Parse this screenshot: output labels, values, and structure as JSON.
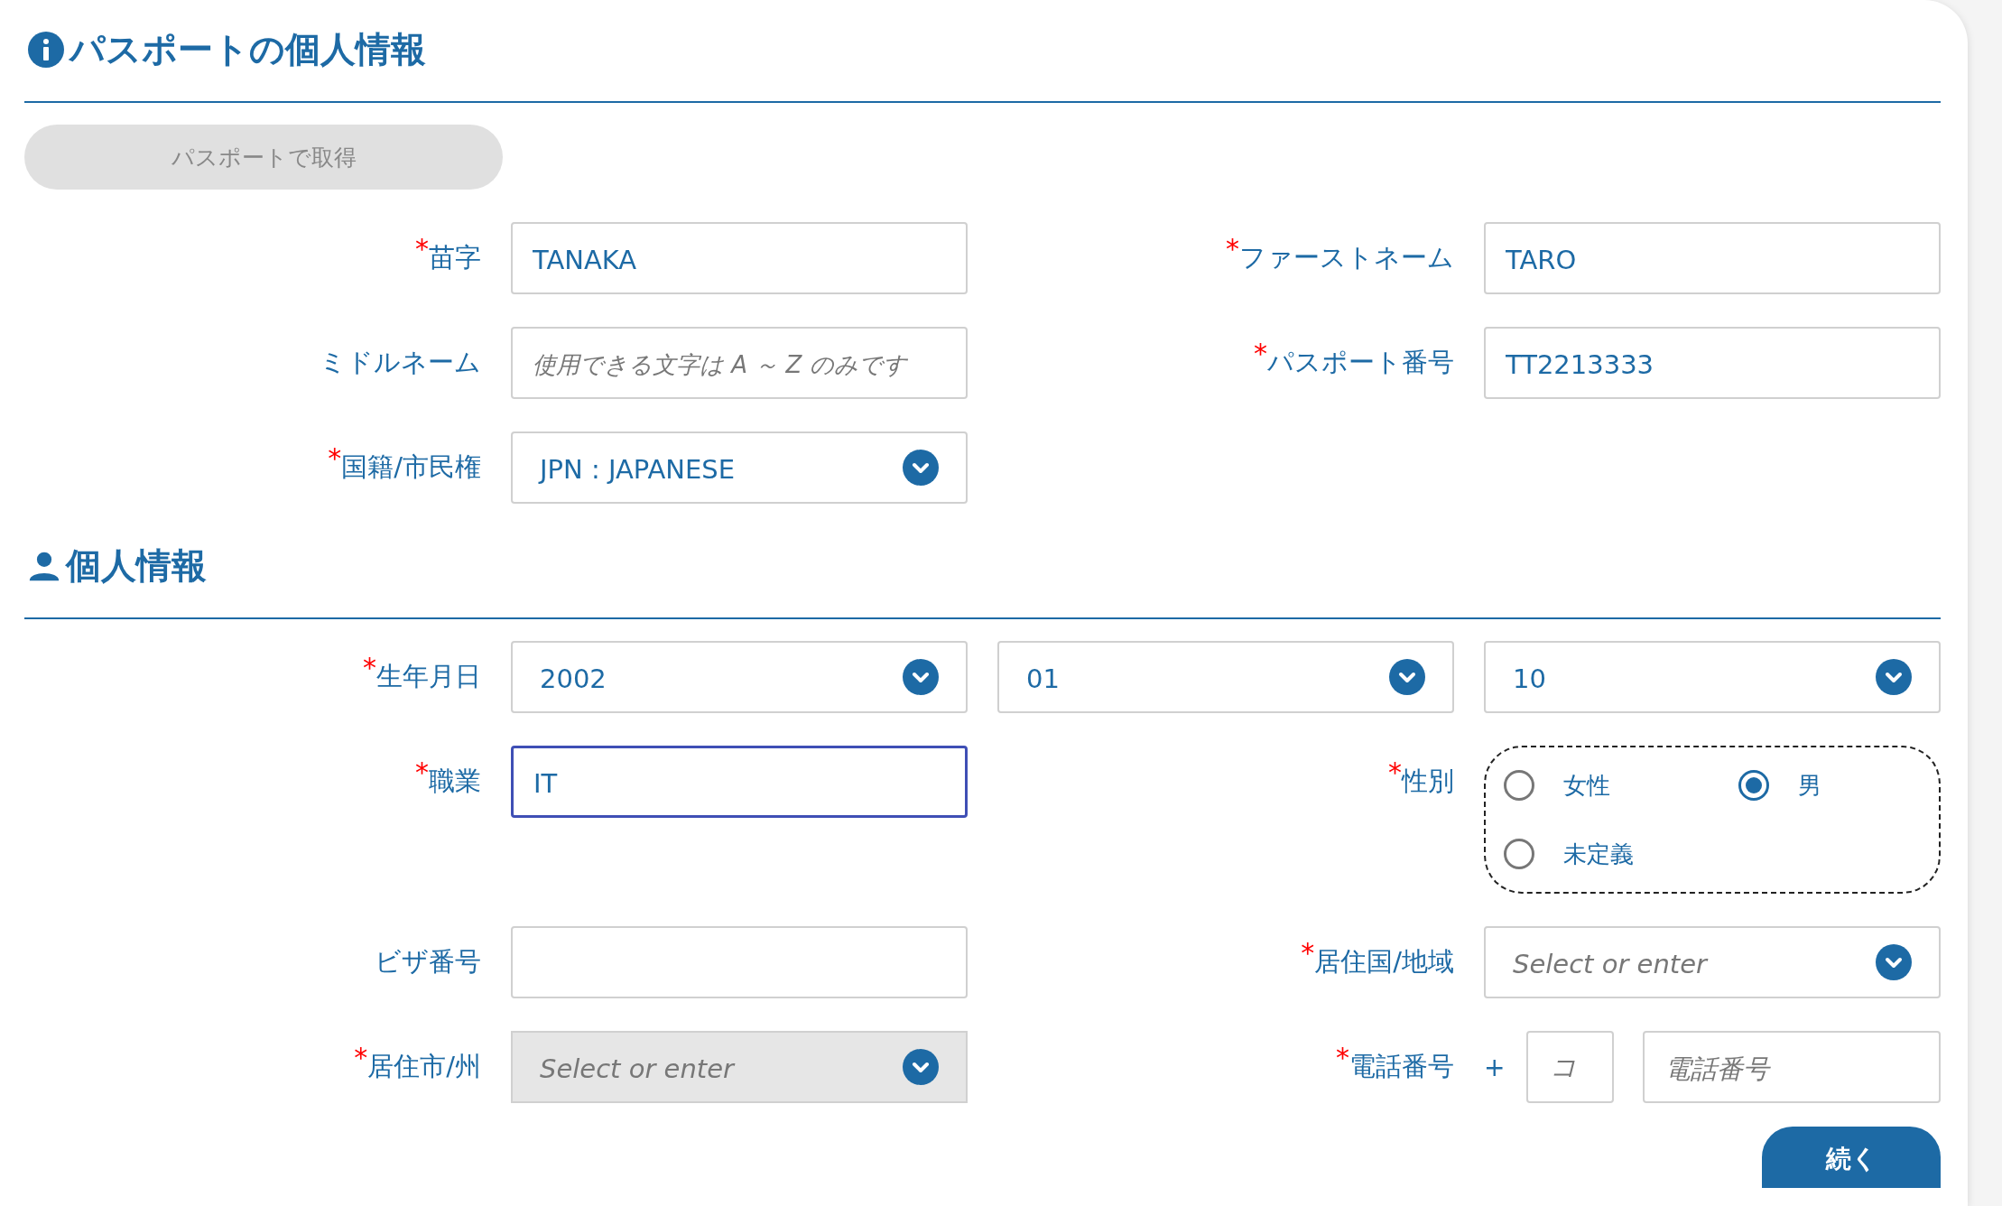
{
  "passport_section": {
    "title": "パスポートの個人情報",
    "fetch_button": {
      "label": "パスポートで取得",
      "disabled": true
    },
    "fields": [
      {
        "kind": "text",
        "label": "苗字",
        "required_mark": "*",
        "value": "TANAKA"
      },
      {
        "kind": "text",
        "label": "ファーストネーム",
        "required_mark": "*",
        "value": "TARO"
      },
      {
        "kind": "text",
        "label": "ミドルネーム",
        "placeholder": "使用できる文字は A ～ Z のみです"
      },
      {
        "kind": "text",
        "label": "パスポート番号",
        "required_mark": "*",
        "value": "TT2213333"
      },
      {
        "kind": "select",
        "label": "国籍/市民権",
        "required_mark": "*",
        "value": "JPN : JAPANESE"
      }
    ]
  },
  "personal_section": {
    "title": "個人情報",
    "fields": [
      {
        "kind": "date",
        "label": "生年月日",
        "required_mark": "*",
        "parts": [
          {
            "value": "2002"
          },
          {
            "value": "01"
          },
          {
            "value": "10"
          }
        ]
      },
      {
        "kind": "text",
        "label": "職業",
        "required_mark": "*",
        "value": "IT",
        "focused": true
      },
      {
        "kind": "radio",
        "label": "性別",
        "required_mark": "*",
        "options": [
          {
            "label": "女性",
            "selected": false
          },
          {
            "label": "男",
            "selected": true
          },
          {
            "label": "未定義",
            "selected": false
          }
        ]
      },
      {
        "kind": "text",
        "label": "ビザ番号"
      },
      {
        "kind": "select",
        "label": "居住国/地域",
        "required_mark": "*",
        "placeholder": "Select or enter"
      },
      {
        "kind": "select",
        "label": "居住市/州",
        "required_mark": "*",
        "placeholder": "Select or enter",
        "disabled": true
      },
      {
        "kind": "phone",
        "label": "電話番号",
        "required_mark": "*",
        "prefix": "+",
        "code_placeholder": "コ",
        "number_placeholder": "電話番号"
      }
    ]
  },
  "continue_button": {
    "label": "続く"
  }
}
